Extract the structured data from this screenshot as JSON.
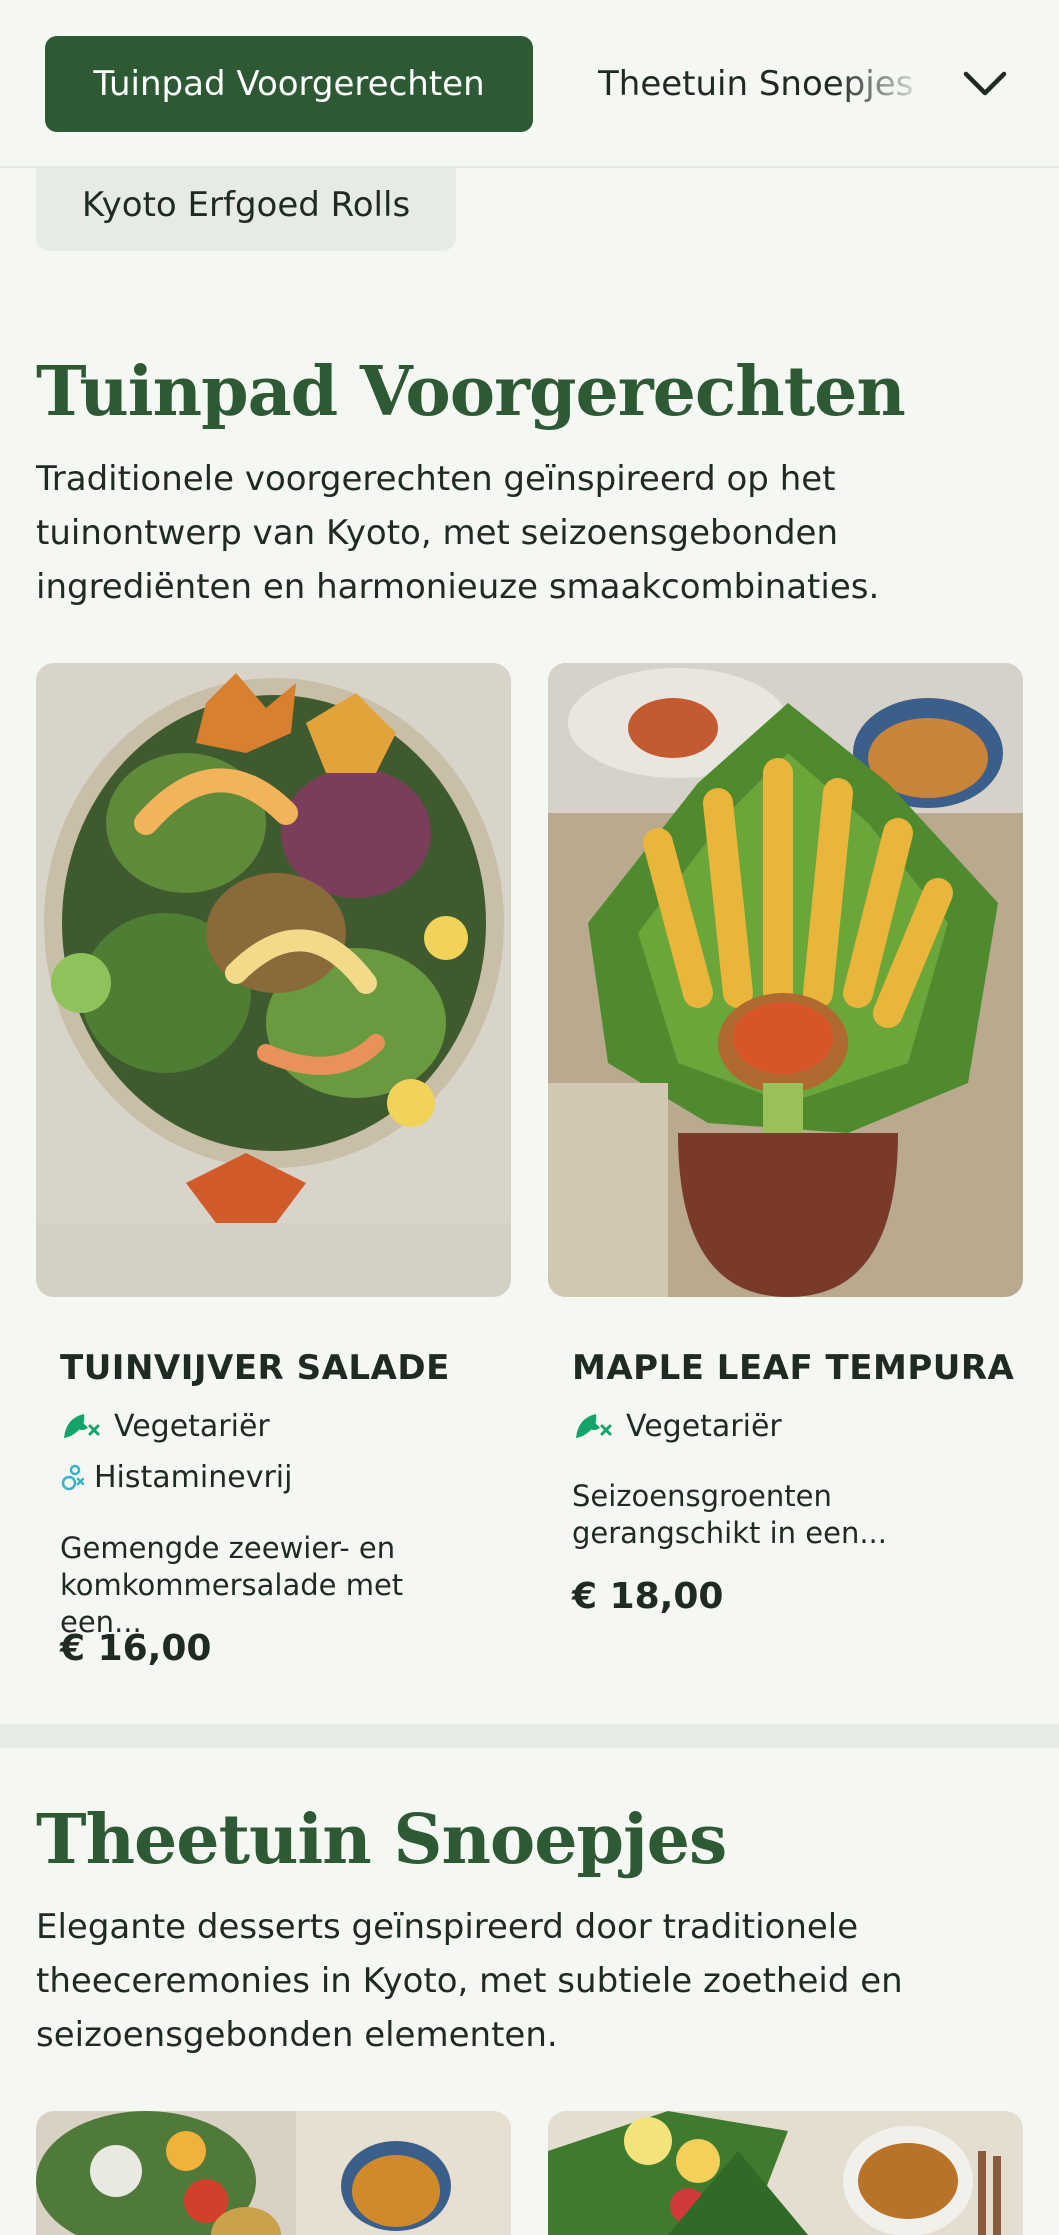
{
  "nav": {
    "active_tab": "Tuinpad Voorgerechten",
    "next_tab": "Theetuin Snoepjes",
    "extra_tab": "Kyoto Erfgoed Rolls",
    "expand_icon": "chevron-down-icon"
  },
  "sections": [
    {
      "title": "Tuinpad Voorgerechten",
      "description": "Traditionele voorgerechten geïnspireerd op het tuinontwerp van Kyoto, met seizoensgebonden ingrediënten en harmonieuze smaakcombinaties.",
      "items": [
        {
          "name": "TUINVIJVER SALADE",
          "tags": [
            {
              "label": "Vegetariër",
              "icon": "vegetarian-leaf-icon",
              "color": "#16a36a"
            },
            {
              "label": "Histaminevrij",
              "icon": "histamine-free-icon",
              "color": "#36b3c9"
            }
          ],
          "description": "Gemengde zeewier- en komkommersalade met een...",
          "price": "€ 16,00"
        },
        {
          "name": "MAPLE LEAF TEMPURA",
          "tags": [
            {
              "label": "Vegetariër",
              "icon": "vegetarian-leaf-icon",
              "color": "#16a36a"
            }
          ],
          "description": "Seizoensgroenten gerangschikt in een...",
          "price": "€ 18,00"
        }
      ]
    },
    {
      "title": "Theetuin Snoepjes",
      "description": "Elegante desserts geïnspireerd door traditionele theeceremonies in Kyoto, met subtiele zoetheid en seizoensgebonden elementen."
    }
  ],
  "colors": {
    "brand_green": "#2d5a35",
    "background": "#f4f7f2",
    "vegetarian": "#16a36a",
    "histamine_free": "#36b3c9"
  }
}
